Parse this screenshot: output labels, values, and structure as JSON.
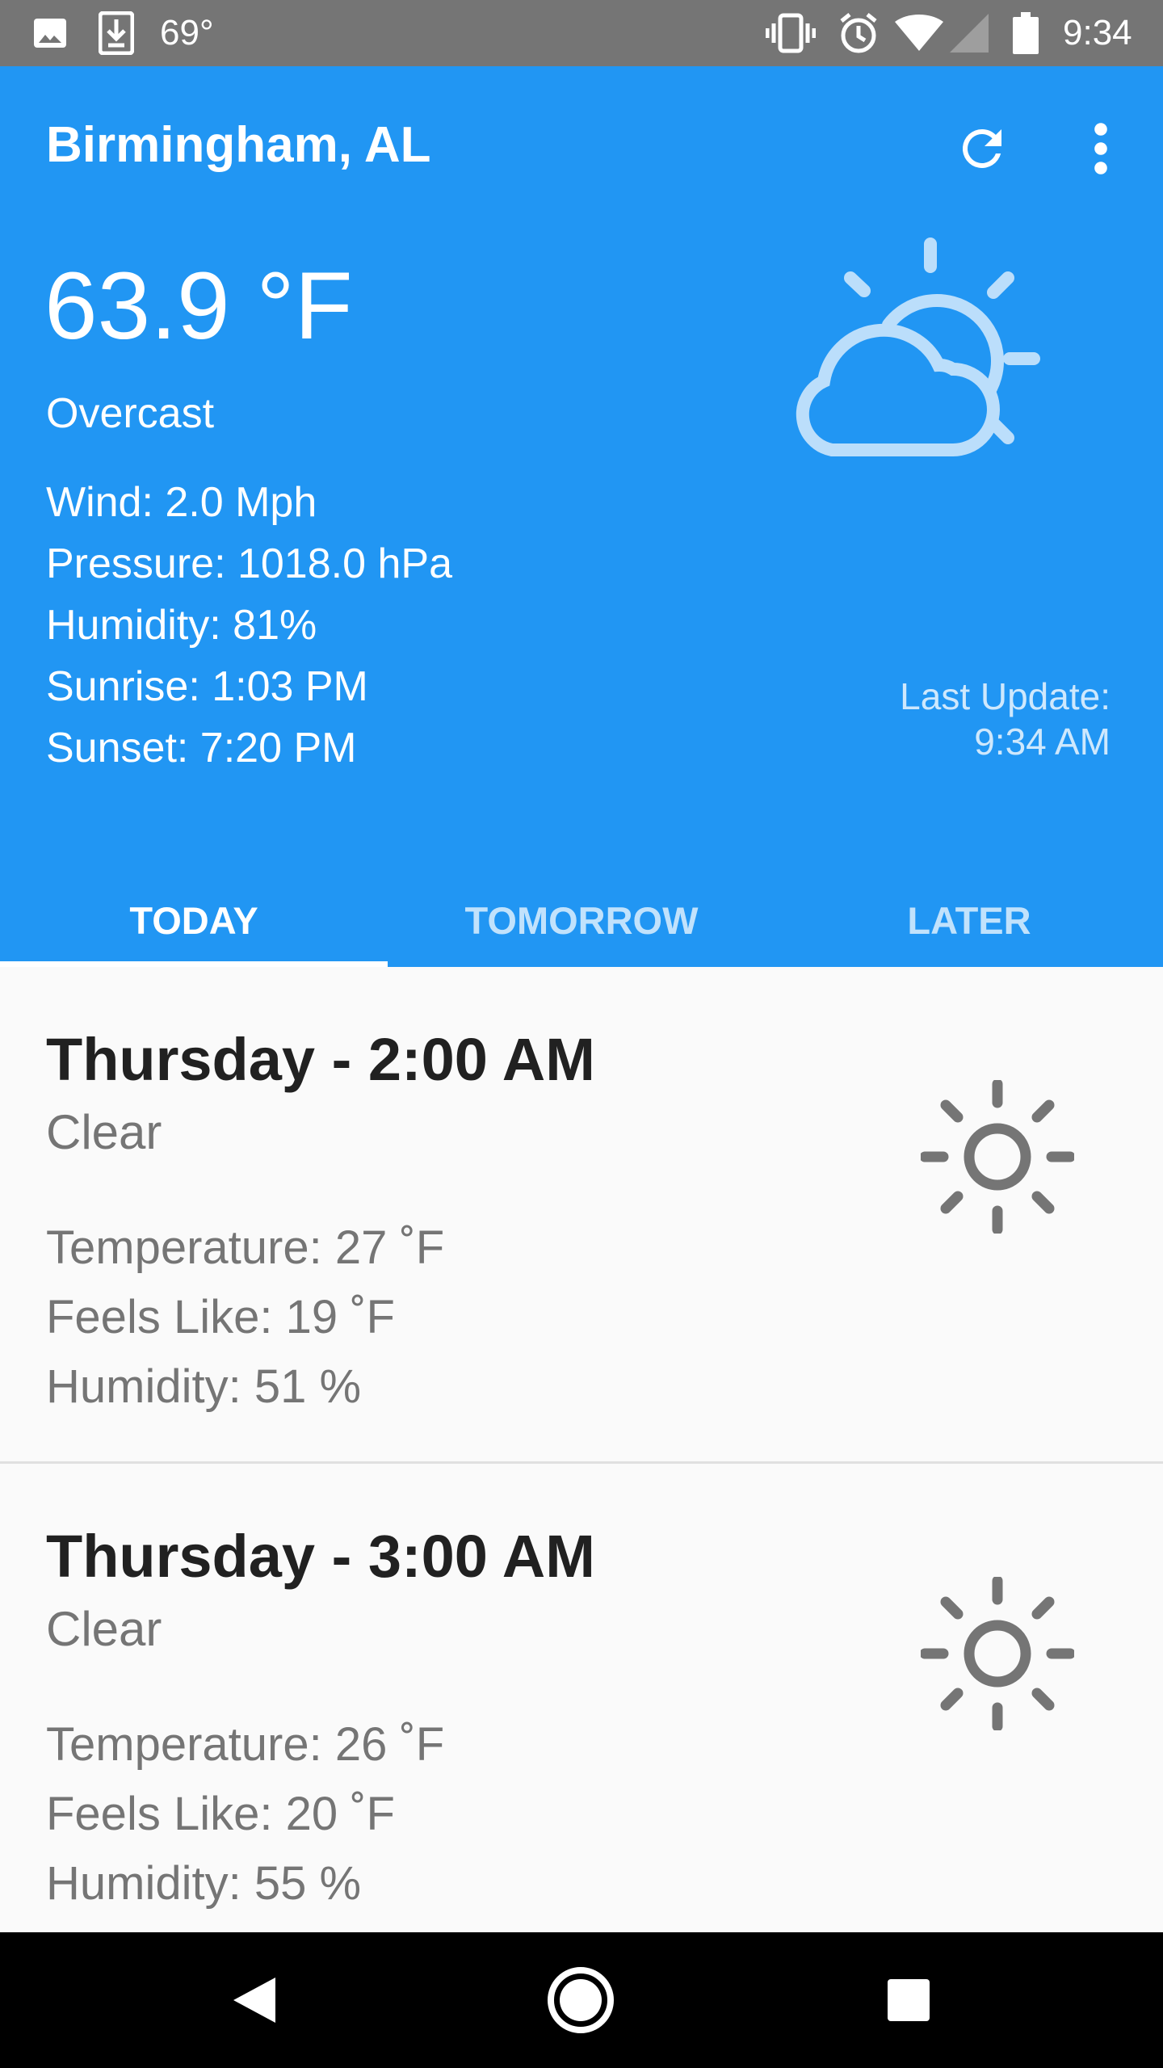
{
  "status_bar": {
    "notification_temp": "69°",
    "time": "9:34",
    "icons": [
      "image-icon",
      "download-icon",
      "vibrate-icon",
      "alarm-icon",
      "wifi-icon",
      "signal-icon",
      "battery-icon"
    ]
  },
  "header": {
    "city": "Birmingham, AL",
    "temperature": "63.9 °F",
    "description": "Overcast",
    "details": [
      "Wind: 2.0 Mph",
      "Pressure: 1018.0 hPa",
      "Humidity: 81%",
      "Sunrise: 1:03 PM",
      "Sunset: 7:20 PM"
    ],
    "last_update_label": "Last Update:",
    "last_update_time": "9:34 AM",
    "weather_icon": "partly-cloudy-icon",
    "background_color": "#2196F3"
  },
  "tabs": [
    {
      "label": "TODAY",
      "active": true
    },
    {
      "label": "TOMORROW",
      "active": false
    },
    {
      "label": "LATER",
      "active": false
    }
  ],
  "forecast": [
    {
      "when": "Thursday - 2:00 AM",
      "condition": "Clear",
      "temperature": "Temperature: 27 ˚F",
      "feels_like": "Feels Like: 19 ˚F",
      "humidity": "Humidity: 51 %",
      "icon": "sun-icon"
    },
    {
      "when": "Thursday - 3:00 AM",
      "condition": "Clear",
      "temperature": "Temperature: 26 ˚F",
      "feels_like": "Feels Like: 20 ˚F",
      "humidity": "Humidity: 55 %",
      "icon": "sun-icon"
    }
  ],
  "nav_bar": {
    "buttons": [
      "back-icon",
      "home-icon",
      "recents-icon"
    ]
  }
}
